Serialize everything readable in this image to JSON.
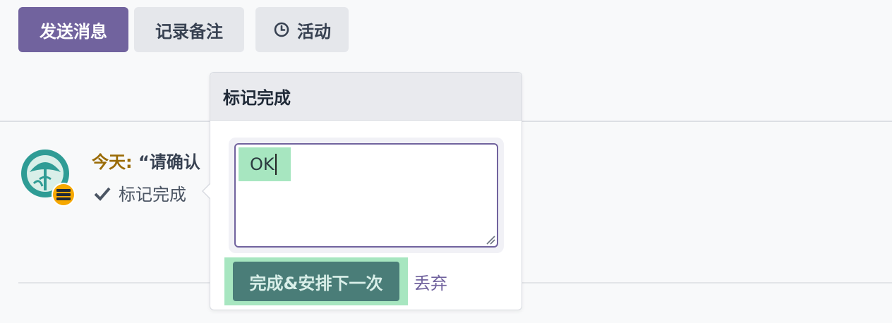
{
  "toolbar": {
    "send_message_label": "发送消息",
    "log_note_label": "记录备注",
    "activity_label": "活动",
    "activity_icon": "clock-icon"
  },
  "activity": {
    "date_label": "今天:",
    "summary": "“请确认",
    "mark_done_label": "标记完成",
    "mark_done_icon": "check-icon",
    "avatar_icon": "user-avatar",
    "type_badge_icon": "activity-type-badge"
  },
  "popover": {
    "title": "标记完成",
    "feedback_value": "OK",
    "done_schedule_label": "完成&安排下一次",
    "discard_label": "丢弃"
  },
  "colors": {
    "primary": "#71639e",
    "secondary": "#e5e7eb",
    "date_text": "#9a6b06",
    "highlight": "#a7e6c0",
    "done_button": "#4a7d78"
  }
}
